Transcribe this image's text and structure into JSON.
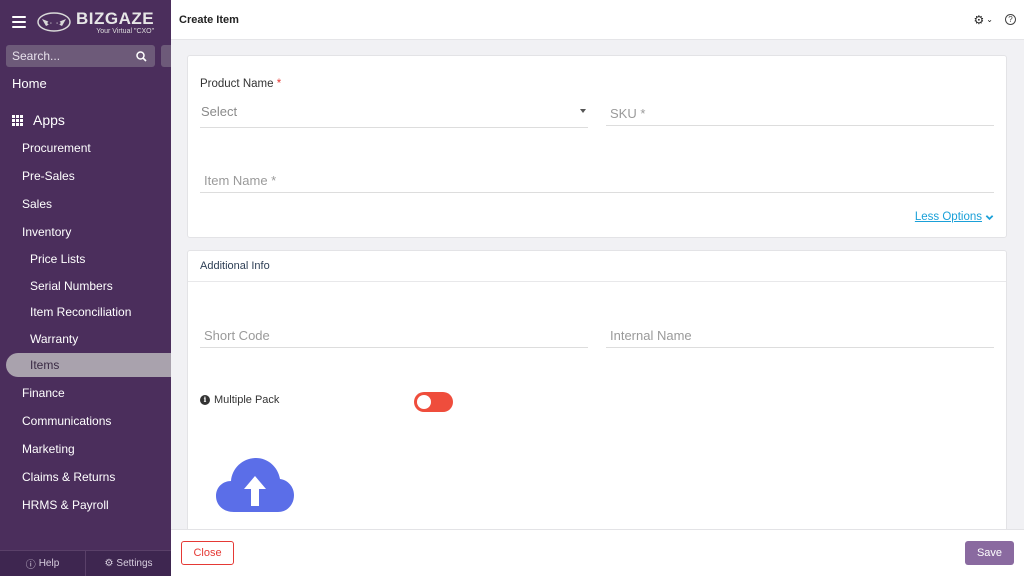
{
  "sidebar": {
    "brand_name": "BIZGAZE",
    "brand_tagline": "Your Virtual \"CXO\"",
    "search_placeholder": "Search...",
    "home_label": "Home",
    "apps_label": "Apps",
    "items": [
      {
        "label": "Procurement"
      },
      {
        "label": "Pre-Sales"
      },
      {
        "label": "Sales"
      },
      {
        "label": "Inventory"
      }
    ],
    "inventory_subitems": [
      {
        "label": "Price Lists"
      },
      {
        "label": "Serial Numbers"
      },
      {
        "label": "Item Reconciliation"
      },
      {
        "label": "Warranty"
      },
      {
        "label": "Items",
        "active": true
      }
    ],
    "items_after": [
      {
        "label": "Finance"
      },
      {
        "label": "Communications"
      },
      {
        "label": "Marketing"
      },
      {
        "label": "Claims & Returns"
      },
      {
        "label": "HRMS & Payroll"
      }
    ],
    "bottom": {
      "help_label": "Help",
      "settings_label": "Settings"
    }
  },
  "header": {
    "title": "Create Item"
  },
  "form": {
    "product_name_label": "Product Name",
    "required_mark": "*",
    "product_name_value": "Select",
    "sku_placeholder": "SKU *",
    "item_name_placeholder": "Item Name *",
    "less_options_label": "Less Options"
  },
  "additional_info": {
    "title": "Additional Info",
    "short_code_placeholder": "Short Code",
    "internal_name_placeholder": "Internal Name",
    "multiple_pack_label": "Multiple Pack",
    "multiple_pack_enabled": false
  },
  "footer": {
    "close_label": "Close",
    "save_label": "Save"
  },
  "colors": {
    "sidebar_bg": "#4b2e5c",
    "toggle_off": "#ef4d3c",
    "save_button": "#8a6aa0",
    "link": "#1aa0d8",
    "upload_icon": "#5b6ee8"
  }
}
